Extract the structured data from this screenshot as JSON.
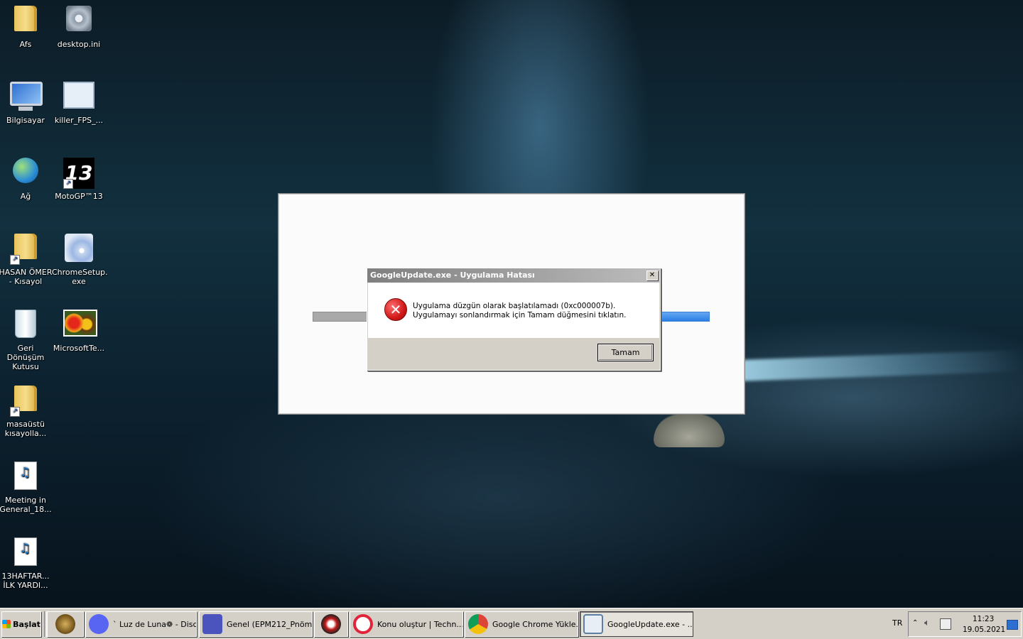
{
  "desktop": {
    "icons": [
      {
        "label": "Afs"
      },
      {
        "label": "desktop.ini"
      },
      {
        "label": "Bilgisayar"
      },
      {
        "label": "killer_FPS_..."
      },
      {
        "label": "Ağ"
      },
      {
        "label": "MotoGP™13"
      },
      {
        "label": "HASAN ÖMER\n- Kısayol"
      },
      {
        "label": "ChromeSetup.\nexe"
      },
      {
        "label": "Geri Dönüşüm\nKutusu"
      },
      {
        "label": "MicrosoftTe..."
      },
      {
        "label": "masaüstü\nkısayolla..."
      },
      {
        "label": "Meeting in\nGeneral_18..."
      },
      {
        "label": "13HAFTAR...\nİLK YARDI..."
      }
    ],
    "moto_glyph": "13"
  },
  "dialog": {
    "title": "GoogleUpdate.exe - Uygulama Hatası",
    "close_glyph": "✕",
    "error_glyph": "✕",
    "message": "Uygulama düzgün olarak başlatılamadı (0xc000007b). Uygulamayı sonlandırmak için Tamam düğmesini tıklatın.",
    "ok_label": "Tamam"
  },
  "taskbar": {
    "start_label": "Başlat",
    "tasks": [
      {
        "label": "",
        "icon": "league-icon"
      },
      {
        "label": "` Luz de Luna❁ - Disc...",
        "icon": "discord-icon"
      },
      {
        "label": "Genel (EPM212_Pnöm...",
        "icon": "teams-icon"
      },
      {
        "label": "",
        "icon": "gpu-z-icon"
      },
      {
        "label": "Konu oluştur | Techn...",
        "icon": "opera-icon"
      },
      {
        "label": "Google Chrome Yükle...",
        "icon": "chrome-installer-icon"
      },
      {
        "label": "GoogleUpdate.exe - ...",
        "icon": "app-window-icon"
      }
    ],
    "language": "TR",
    "time": "11:23",
    "date": "19.05.2021"
  }
}
